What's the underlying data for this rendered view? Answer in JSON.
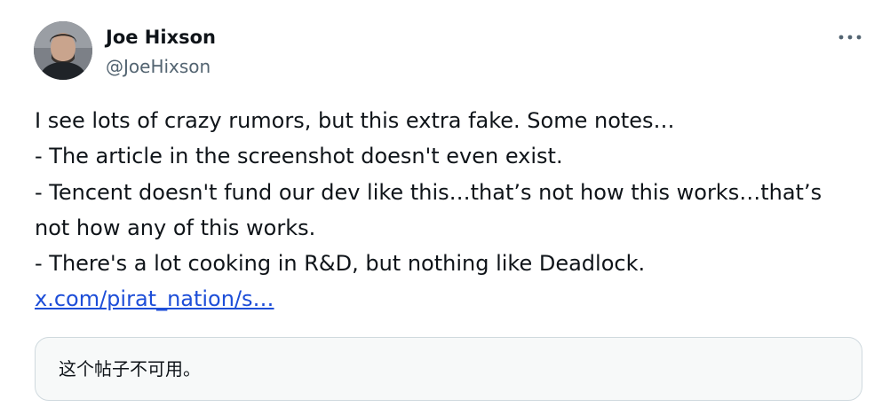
{
  "author": {
    "display_name": "Joe Hixson",
    "handle": "@JoeHixson",
    "avatar_icon": "person-photo-avatar"
  },
  "menu": {
    "icon": "more-horizontal-icon"
  },
  "tweet": {
    "lines": [
      "I see lots of crazy rumors, but this extra fake. Some notes…",
      "- The article in the screenshot doesn't even exist.",
      "- Tencent doesn't fund our dev like this…that’s not how this works…that’s",
      "not how any of this works.",
      "- There's a lot cooking in R&D, but nothing like Deadlock."
    ],
    "link_text": "x.com/pirat_nation/s…"
  },
  "quoted_post": {
    "unavailable_text": "这个帖子不可用。"
  },
  "colors": {
    "text_primary": "#0f1419",
    "text_secondary": "#536471",
    "link": "#1d4ed8",
    "border": "#cfd9de",
    "quote_background": "#f7f9f9"
  }
}
